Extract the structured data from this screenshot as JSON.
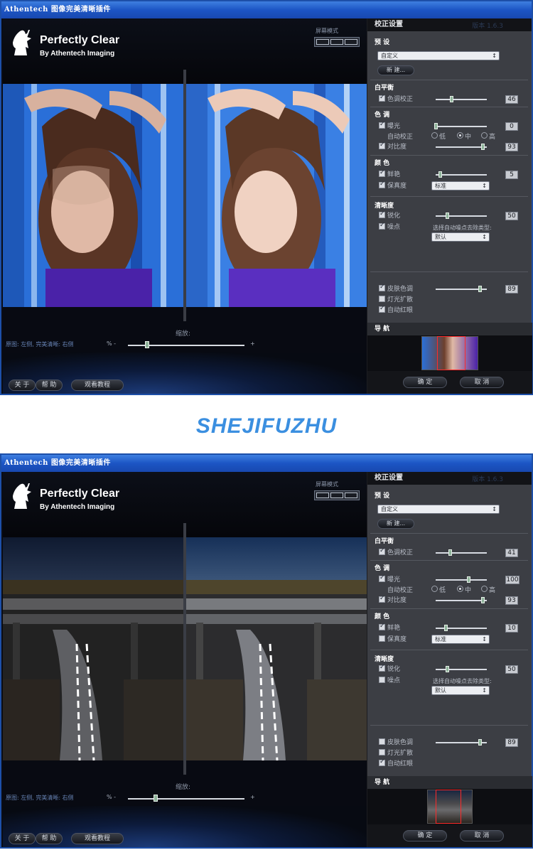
{
  "watermark": "SHEJIFUZHU",
  "windows": [
    {
      "title": "Athentech 图像完美清晰插件",
      "logo_title": "Perfectly Clear",
      "logo_subtitle": "By Athentech Imaging",
      "screen_mode": "屏幕模式",
      "zoom_label": "缩放:",
      "caption": "原图: 左侧, 完美清晰: 右侧",
      "zoom_minus": "% -",
      "zoom_plus": "+",
      "zoom_level": 0.17,
      "about_button": "关 于",
      "help_button": "帮 助",
      "tutorial_button": "观看教程",
      "panel": {
        "header": "校正设置",
        "version": "版本 1.6.3",
        "preset_label": "预 设",
        "preset_value": "自定义",
        "new_button": "新 建...",
        "white_balance": "白平衡",
        "tint_label": "色调校正",
        "tint_checked": true,
        "tint_value": "46",
        "tone": "色 调",
        "exposure_label": "曝光",
        "exposure_checked": true,
        "exposure_value": "0",
        "auto_correct": "自动校正",
        "radio_low": "低",
        "radio_mid": "中",
        "radio_high": "高",
        "contrast_label": "对比度",
        "contrast_checked": true,
        "contrast_value": "93",
        "color": "颜 色",
        "vivid_label": "鲜艳",
        "vivid_checked": true,
        "vivid_value": "5",
        "fidelity_label": "保真度",
        "fidelity_checked": true,
        "fidelity_select": "标准",
        "sharpness": "清晰度",
        "sharpen_label": "锐化",
        "sharpen_checked": true,
        "sharpen_value": "50",
        "noise_label": "噪点",
        "noise_checked": true,
        "noise_type_label": "选择自动噪点去除类型:",
        "noise_select": "默认",
        "skin_label": "皮肤色调",
        "skin_checked": true,
        "skin_value": "89",
        "light_label": "灯光扩散",
        "light_checked": false,
        "redeye_label": "自动红眼",
        "redeye_checked": true,
        "nav_label": "导 航",
        "ok_button": "确 定",
        "cancel_button": "取 消"
      }
    },
    {
      "title": "Athentech 图像完美清晰插件",
      "logo_title": "Perfectly Clear",
      "logo_subtitle": "By Athentech Imaging",
      "screen_mode": "屏幕模式",
      "zoom_label": "缩放:",
      "caption": "原图: 左侧, 完美清晰: 右侧",
      "zoom_minus": "% -",
      "zoom_plus": "+",
      "zoom_level": 0.23,
      "about_button": "关 于",
      "help_button": "帮 助",
      "tutorial_button": "观看教程",
      "panel": {
        "header": "校正设置",
        "version": "版本 1.6.3",
        "preset_label": "预 设",
        "preset_value": "自定义",
        "new_button": "新 建...",
        "white_balance": "白平衡",
        "tint_label": "色调校正",
        "tint_checked": true,
        "tint_value": "41",
        "tone": "色 调",
        "exposure_label": "曝光",
        "exposure_checked": true,
        "exposure_value": "100",
        "auto_correct": "自动校正",
        "radio_low": "低",
        "radio_mid": "中",
        "radio_high": "高",
        "contrast_label": "对比度",
        "contrast_checked": true,
        "contrast_value": "93",
        "color": "颜 色",
        "vivid_label": "鲜艳",
        "vivid_checked": true,
        "vivid_value": "10",
        "fidelity_label": "保真度",
        "fidelity_checked": false,
        "fidelity_select": "标准",
        "sharpness": "清晰度",
        "sharpen_label": "锐化",
        "sharpen_checked": true,
        "sharpen_value": "50",
        "noise_label": "噪点",
        "noise_checked": false,
        "noise_type_label": "选择自动噪点去除类型:",
        "noise_select": "默认",
        "skin_label": "皮肤色调",
        "skin_checked": false,
        "skin_value": "89",
        "light_label": "灯光扩散",
        "light_checked": false,
        "redeye_label": "自动红眼",
        "redeye_checked": true,
        "nav_label": "导 航",
        "ok_button": "确 定",
        "cancel_button": "取 消"
      }
    }
  ]
}
